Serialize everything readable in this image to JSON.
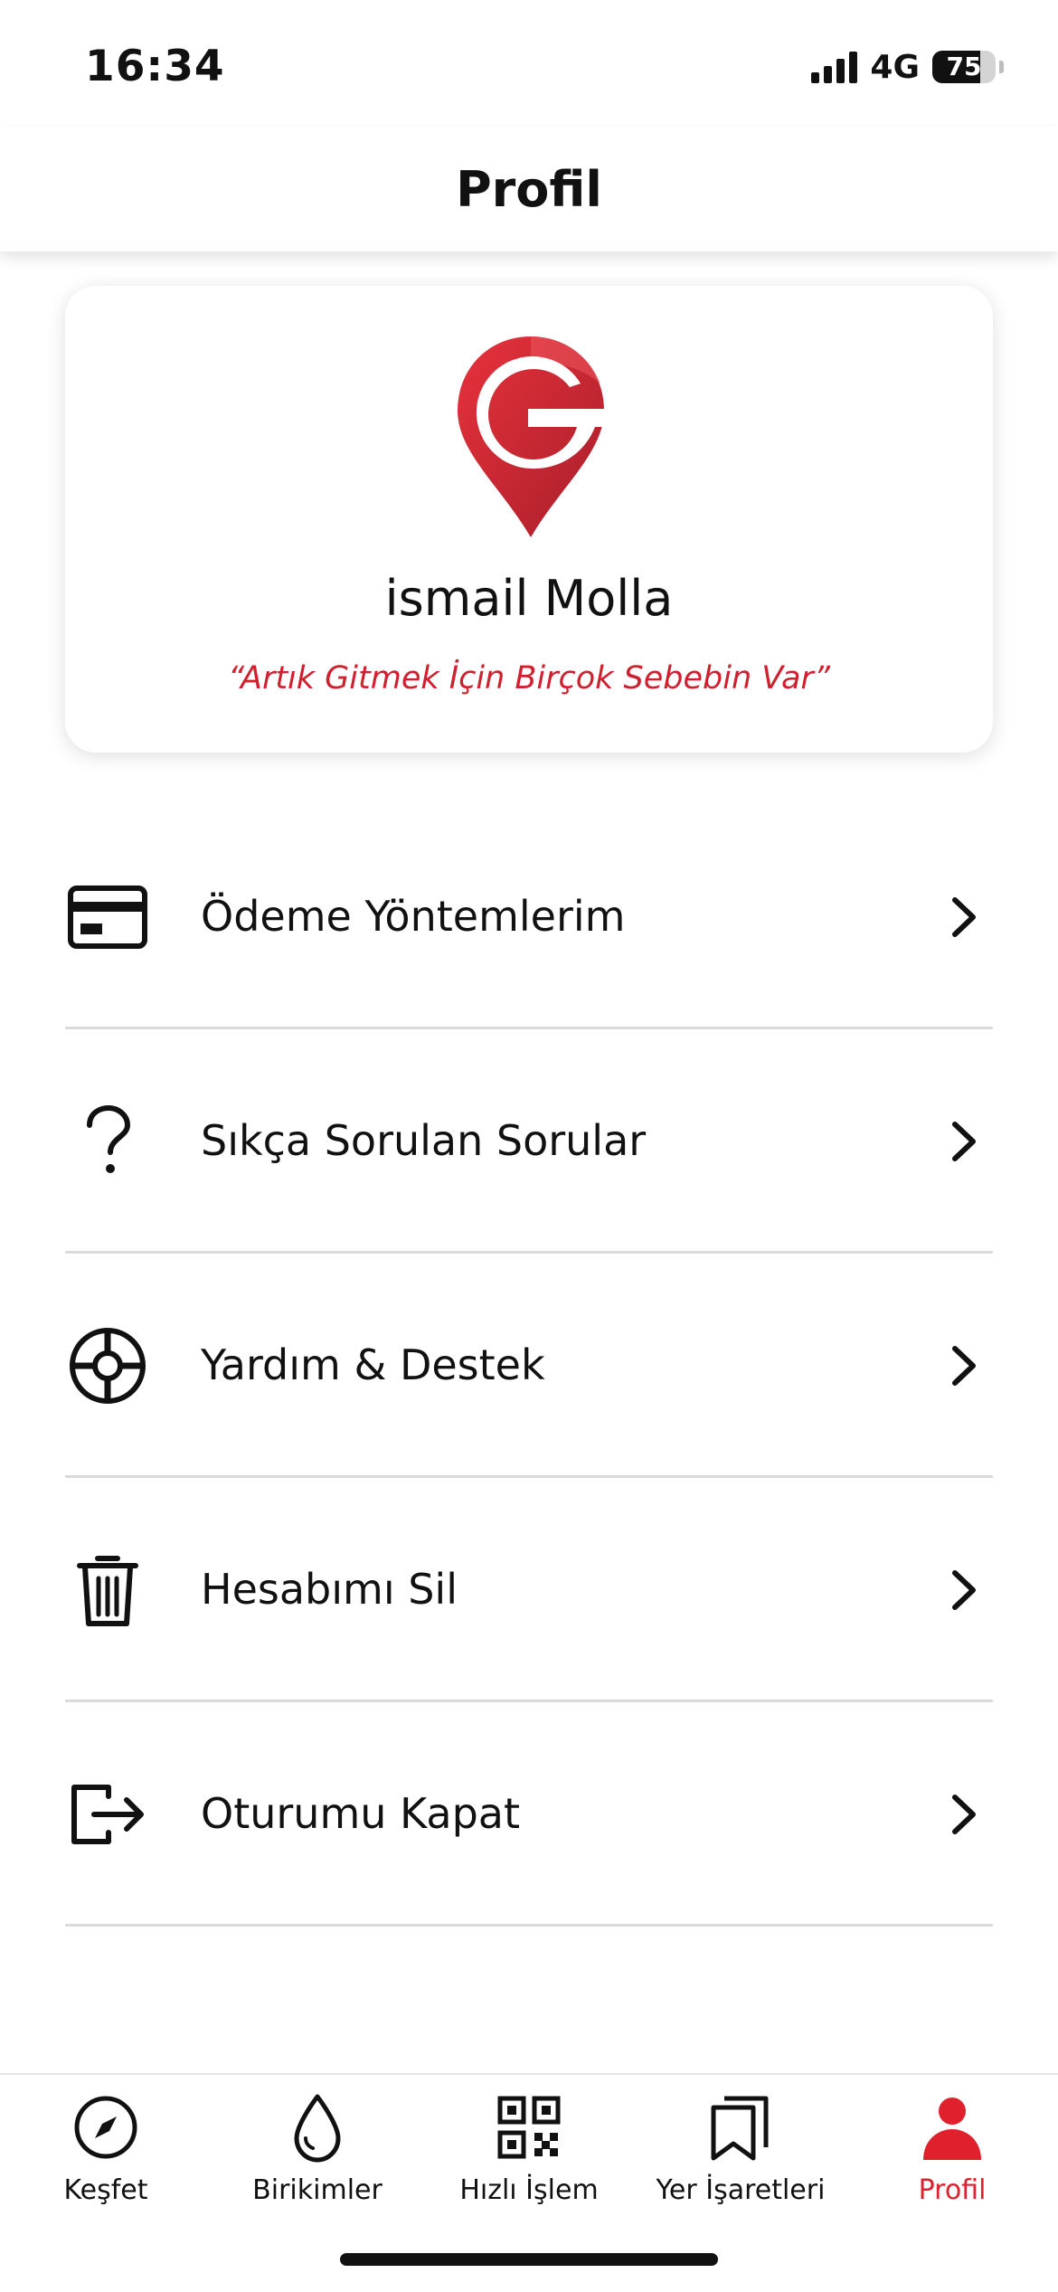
{
  "status_bar": {
    "time": "16:34",
    "network": "4G",
    "battery": "75"
  },
  "header": {
    "title": "Profil"
  },
  "profile": {
    "name": "ismail Molla",
    "slogan": "“Artık Gitmek İçin Birçok Sebebin Var”",
    "logo_icon": "location-pin-g-logo"
  },
  "menu": [
    {
      "label": "Ödeme Yöntemlerim",
      "icon": "credit-card-icon"
    },
    {
      "label": "Sıkça Sorulan Sorular",
      "icon": "question-mark-icon"
    },
    {
      "label": "Yardım & Destek",
      "icon": "lifebuoy-icon"
    },
    {
      "label": "Hesabımı Sil",
      "icon": "trash-icon"
    },
    {
      "label": "Oturumu Kapat",
      "icon": "logout-icon"
    }
  ],
  "tabs": [
    {
      "label": "Keşfet",
      "icon": "compass-icon"
    },
    {
      "label": "Birikimler",
      "icon": "drop-icon"
    },
    {
      "label": "Hızlı İşlem",
      "icon": "qr-code-icon"
    },
    {
      "label": "Yer İşaretleri",
      "icon": "bookmarks-icon"
    },
    {
      "label": "Profil",
      "icon": "user-icon",
      "active": true
    }
  ],
  "colors": {
    "brand_red": "#e0202c",
    "slogan_red": "#d0202e",
    "divider": "#d9d9d9"
  }
}
